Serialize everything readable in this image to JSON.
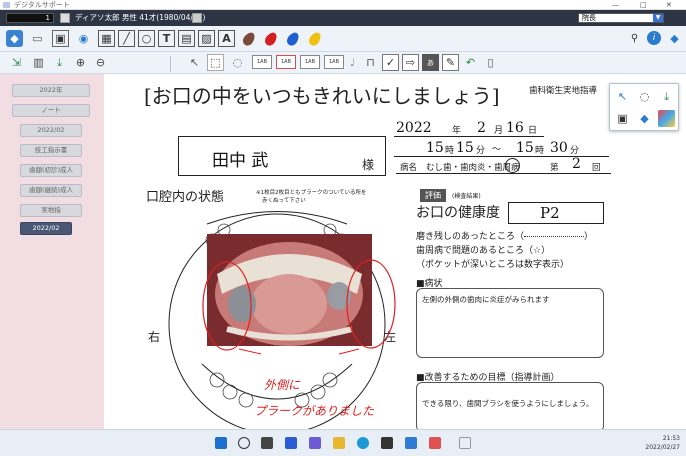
{
  "window": {
    "title": "デジタルサポート"
  },
  "patient": {
    "id": "1",
    "info": "ディアソ太郎 男性 41才(1980/04/21)",
    "role": "院長"
  },
  "sidebar": {
    "items": [
      "2022年",
      "ノート",
      "2022/02",
      "技工指示書",
      "歯額(初診)成人",
      "歯額(継続)成人",
      "実地指",
      "2022/02"
    ],
    "selected_index": 7
  },
  "document": {
    "title": "[お口の中をいつもきれいにしましょう]",
    "header_right": "歯科衛生実地指導",
    "date": {
      "year": "2022",
      "year_unit": "年",
      "month": "2",
      "month_unit": "月",
      "day": "16",
      "day_unit": "日"
    },
    "time": {
      "start_h": "15",
      "h_unit": "時",
      "start_m": "15",
      "m_unit": "分",
      "tilde": "〜",
      "end_h": "15",
      "end_m": "30"
    },
    "patient_name": "田中 武",
    "honorific": "様",
    "diagnosis_label": "病名",
    "diagnosis": "むし歯・歯肉炎・歯周病",
    "visit_prefix": "第",
    "visit_number": "2",
    "visit_suffix": "回",
    "mouth_title": "口腔内の状態",
    "mouth_note_1": "※1枚目2枚目ともプラークのついている所を",
    "mouth_note_2": "赤くぬって下さい",
    "label_right": "右",
    "label_left": "左",
    "annotation_1": "外側に",
    "annotation_2": "プラークがありました",
    "eval_label": "評価",
    "eval_sub": "(検査結果)",
    "health_label": "お口の健康度",
    "health_value": "P2",
    "legend_1": "磨き残しのあったところ（",
    "legend_1b": "）",
    "legend_2": "歯周病で問題のあるところ（☆）",
    "legend_3": "（ポケットが深いところは数字表示）",
    "symptoms_title": "■病状",
    "symptoms_text": "左側の外側の歯肉に炎症がみられます",
    "goal_title": "■改善するための目標（指導計画）",
    "goal_text": "できる限り、歯間ブラシを使うようにしましょう。"
  },
  "taskbar": {
    "time": "21:53",
    "date": "2022/02/27"
  },
  "colors": {
    "accent": "#3a6fd8",
    "sidebar_bg": "#f2dde2",
    "annotation": "#e02020"
  },
  "icons": [
    "tooth-icon",
    "folder-icon",
    "monitor-icon",
    "tooth-icon",
    "scan-icon",
    "pen-icon",
    "circle-icon",
    "text-icon",
    "stamp-icon",
    "image-icon",
    "text-a-icon",
    "brown-drop-icon",
    "red-drop-icon",
    "blue-drop-icon",
    "yellow-drop-icon",
    "search-icon",
    "info-icon",
    "tooth-view-icon"
  ]
}
